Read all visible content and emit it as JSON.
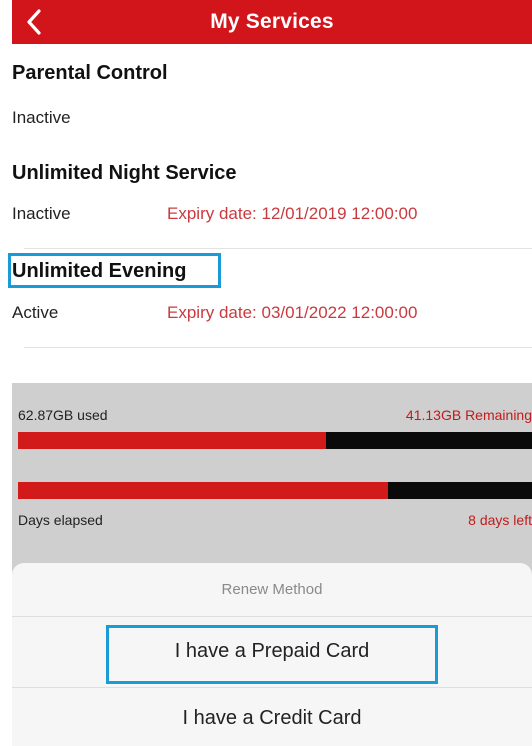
{
  "header": {
    "title": "My Services",
    "back_icon": "chevron-left-icon"
  },
  "services": [
    {
      "name": "Parental Control",
      "status": "Inactive",
      "expiry": ""
    },
    {
      "name": "Unlimited Night Service",
      "status": "Inactive",
      "expiry": "Expiry date: 12/01/2019 12:00:00"
    },
    {
      "name": "Unlimited Evening",
      "status": "Active",
      "expiry": "Expiry date: 03/01/2022 12:00:00"
    }
  ],
  "usage": {
    "used_label": "62.87GB used",
    "remaining_label": "41.13GB Remaining",
    "data_used_fraction": 0.6,
    "days_label": "Days elapsed",
    "days_left_label": "8 days left",
    "days_elapsed_fraction": 0.72
  },
  "renew_sheet": {
    "title": "Renew Method",
    "options": [
      "I have a Prepaid Card",
      "I have a Credit Card"
    ]
  },
  "colors": {
    "brand": "#d2141b",
    "highlight": "#1a9ad6",
    "expiry_text": "#c93a3f"
  }
}
